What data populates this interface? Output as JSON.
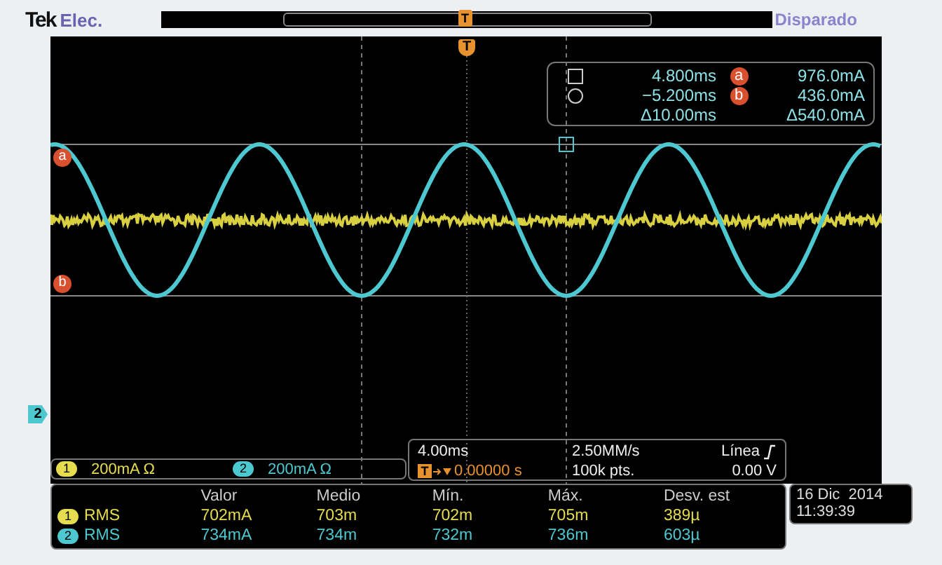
{
  "header": {
    "brand": "Tek",
    "mode": "Elec.",
    "trigger_status": "Disparado",
    "record_marker": "T"
  },
  "trigger_marker": "T",
  "cursor_labels": [
    "a",
    "b"
  ],
  "channel_marker": {
    "number": "2",
    "color": "#4ec8d0"
  },
  "cursor_readout": [
    {
      "kind": "square",
      "time": "4.800ms",
      "marker": "a",
      "value": "976.0mA"
    },
    {
      "kind": "circle",
      "time": "−5.200ms",
      "marker": "b",
      "value": "436.0mA"
    },
    {
      "kind": "delta",
      "time": "Δ10.00ms",
      "value": "Δ540.0mA"
    }
  ],
  "channels": [
    {
      "number": "1",
      "scale": "200mA Ω",
      "color": "#e6dc50"
    },
    {
      "number": "2",
      "scale": "200mA Ω",
      "color": "#4ec8d0"
    }
  ],
  "timebase": {
    "time_div": "4.00ms",
    "sample_rate": "2.50MM/s",
    "trigger_source": "Línea",
    "trigger_label": "T",
    "delay": "0.00000 s",
    "record_length": "100k pts.",
    "trigger_level": "0.00 V"
  },
  "measurements": {
    "columns": [
      "Valor",
      "Medio",
      "Mín.",
      "Máx.",
      "Desv. est"
    ],
    "rows": [
      {
        "channel": "1",
        "color": "#e6dc50",
        "type": "RMS",
        "values": [
          "702mA",
          "703m",
          "702m",
          "705m",
          "389µ"
        ]
      },
      {
        "channel": "2",
        "color": "#4ec8d0",
        "type": "RMS",
        "values": [
          "734mA",
          "734m",
          "732m",
          "736m",
          "603µ"
        ]
      }
    ]
  },
  "datetime": {
    "date": "16 Dic  2014",
    "time": "11:39:39"
  }
}
